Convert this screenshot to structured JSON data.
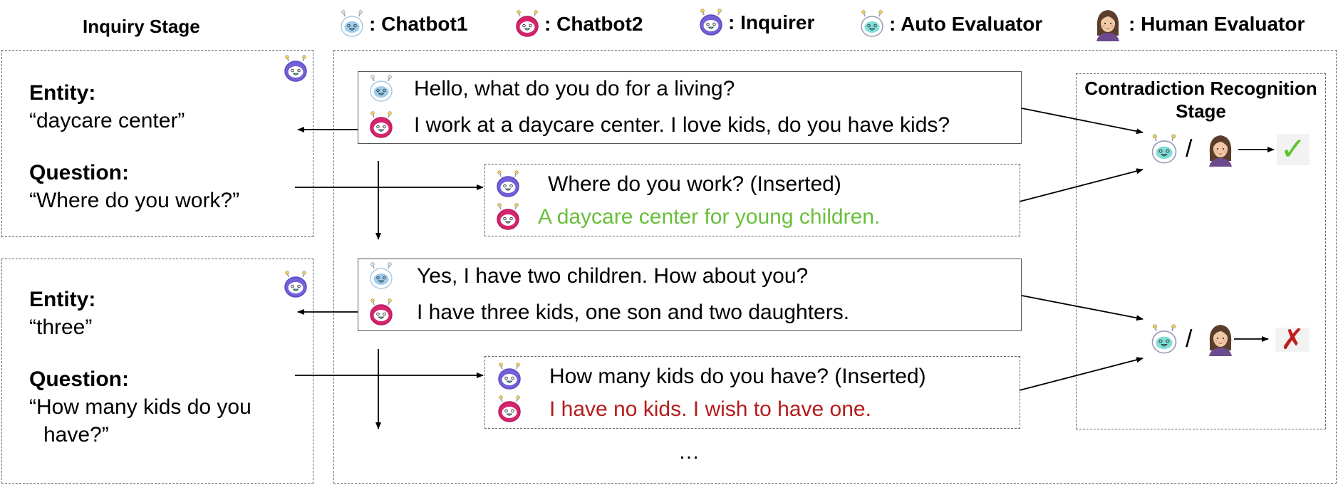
{
  "legend": {
    "inquiry_stage_title": "Inquiry Stage",
    "items": [
      {
        "icon": "chatbot1-icon",
        "label": ": Chatbot1"
      },
      {
        "icon": "chatbot2-icon",
        "label": ": Chatbot2"
      },
      {
        "icon": "inquirer-icon",
        "label": ": Inquirer"
      },
      {
        "icon": "auto-evaluator-icon",
        "label": ": Auto Evaluator"
      },
      {
        "icon": "human-evaluator-icon",
        "label": ": Human Evaluator"
      }
    ]
  },
  "inquiry": [
    {
      "entity_label": "Entity:",
      "entity_value": "“daycare center”",
      "question_label": "Question:",
      "question_value": "“Where do you work?”"
    },
    {
      "entity_label": "Entity:",
      "entity_value": "“three”",
      "question_label": "Question:",
      "question_value_line1": "“How many kids do you",
      "question_value_line2": "have?”"
    }
  ],
  "dialogue": [
    {
      "chatbot1": "Hello, what do you do for a living?",
      "chatbot2": "I work at a daycare center. I love kids, do you have kids?",
      "inserted_question": "Where do you work? (Inserted)",
      "inserted_answer": "A daycare center for young children.",
      "result": "consistent"
    },
    {
      "chatbot1": "Yes, I have two children. How about you?",
      "chatbot2": "I have three kids, one son and two daughters.",
      "inserted_question": "How many kids do you have? (Inserted)",
      "inserted_answer": "I have no kids. I wish to have one.",
      "result": "contradiction"
    }
  ],
  "ellipsis": "…",
  "recognition": {
    "title_line1": "Contradiction Recognition",
    "title_line2": "Stage",
    "separator": "/",
    "results": [
      {
        "icon": "checkmark-icon",
        "glyph": "✓"
      },
      {
        "icon": "cross-icon",
        "glyph": "✗"
      }
    ]
  },
  "colors": {
    "consistent_answer": "#6abf3a",
    "contradictory_answer": "#b51c1c",
    "chatbot1": "#9ecbec",
    "chatbot2": "#d6246e",
    "inquirer": "#7460d8",
    "auto_evaluator": "#7fded8"
  }
}
